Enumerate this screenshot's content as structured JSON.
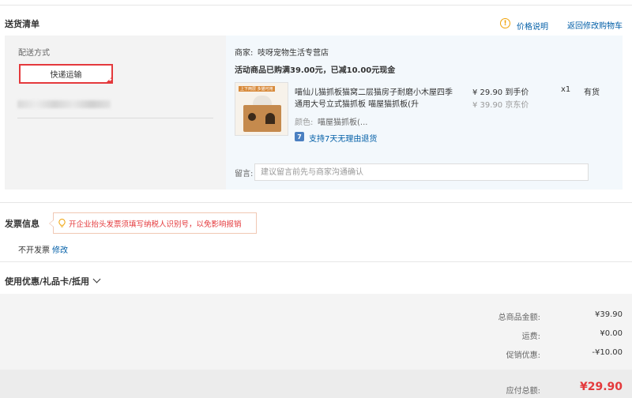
{
  "header": {
    "title": "送货清单",
    "price_note": "价格说明",
    "back_to_cart": "返回修改购物车"
  },
  "shipping": {
    "label": "配送方式",
    "method": "快递运输"
  },
  "shop": {
    "label": "商家:",
    "name": "吱呀宠物生活专营店",
    "promo": "活动商品已购满39.00元，已减10.00元现金"
  },
  "item": {
    "thumb_ribbon": "上下两层 多猫可用",
    "name_line1": "喵仙儿猫抓板猫窝二层猫房子耐磨小木屋四季",
    "name_line2": "通用大号立式猫抓板 喵屋猫抓板(升",
    "price": "¥ 29.90 到手价",
    "old_price": "¥ 39.90 京东价",
    "qty": "x1",
    "stock": "有货",
    "color_label": "颜色:",
    "color_value": "喵屋猫抓板(...",
    "return_icon": "7",
    "return_text": "支持7天无理由退货"
  },
  "note": {
    "label": "留言:",
    "placeholder": "建议留言前先与商家沟通确认"
  },
  "invoice": {
    "title": "发票信息",
    "tip": "开企业抬头发票须填写纳税人识别号，以免影响报销",
    "status": "不开发票",
    "edit": "修改"
  },
  "coupon": {
    "title": "使用优惠/礼品卡/抵用"
  },
  "summary": {
    "goods_label": "总商品金额:",
    "goods_value": "¥39.90",
    "shipping_label": "运费:",
    "shipping_value": "¥0.00",
    "discount_label": "促销优惠:",
    "discount_value": "-¥10.00",
    "total_label": "应付总额:",
    "total_value": "¥29.90"
  },
  "colors": {
    "accent": "#e4393c",
    "link": "#005ea7",
    "warning": "#f0a30a"
  }
}
